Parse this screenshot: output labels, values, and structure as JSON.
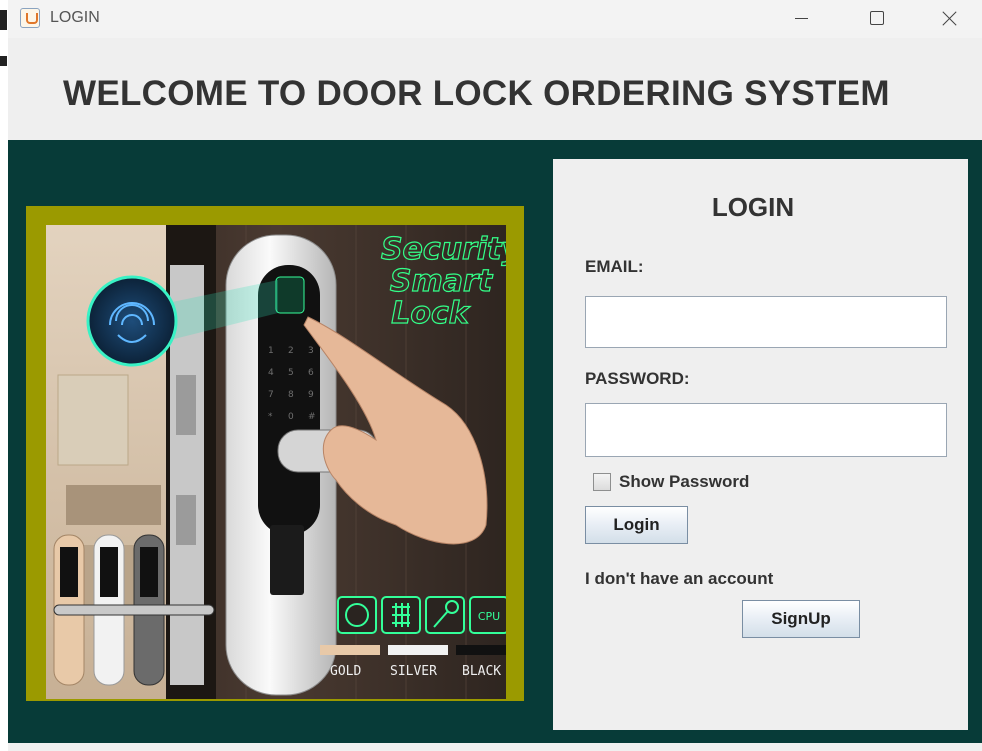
{
  "window": {
    "title": "LOGIN",
    "icon": "java-app-icon"
  },
  "header": {
    "title": "WELCOME TO DOOR LOCK ORDERING SYSTEM"
  },
  "product_image": {
    "alt": "Security Smart Lock",
    "lines": [
      "Security",
      "Smart",
      "Lock"
    ],
    "feature_icons": [
      "fingerprint-icon",
      "keypad-icon",
      "key-icon",
      "cpu-icon"
    ],
    "cpu_label": "CPU",
    "swatches": [
      {
        "label": "GOLD",
        "color": "#e8c9a8"
      },
      {
        "label": "SILVER",
        "color": "#f2f2f2"
      },
      {
        "label": "BLACK",
        "color": "#111111"
      }
    ]
  },
  "login": {
    "title": "LOGIN",
    "email_label": "EMAIL:",
    "email_value": "",
    "password_label": "PASSWORD:",
    "password_value": "",
    "show_password_label": "Show Password",
    "show_password_checked": false,
    "login_button": "Login",
    "no_account_text": "I don't have an account",
    "signup_button": "SignUp"
  },
  "colors": {
    "main_background": "#073b38",
    "image_frame": "#9b9a00",
    "panel": "#efefef",
    "header_text": "#333333"
  }
}
